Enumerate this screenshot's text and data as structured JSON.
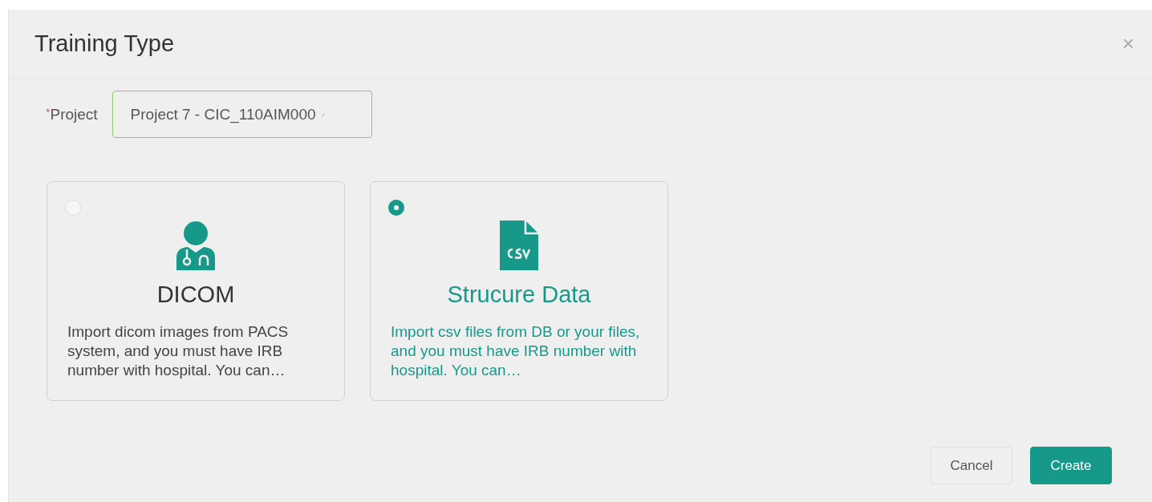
{
  "dialog": {
    "title": "Training Type",
    "close": "×"
  },
  "project_field": {
    "label": "Project",
    "required_mark": "*",
    "value": "Project 7 - CIC_110AIM000"
  },
  "options": [
    {
      "kind": "doctor",
      "title": "DICOM",
      "description": "Import dicom images from PACS system, and you must have IRB number with hospital. You can…",
      "selected": false
    },
    {
      "kind": "csv",
      "title": "Strucure Data",
      "description": "Import csv files from DB or your files, and you must have IRB number with hospital. You can…",
      "selected": true
    }
  ],
  "buttons": [
    {
      "kind": "secondary",
      "label": "Cancel"
    },
    {
      "kind": "primary",
      "label": "Create"
    }
  ]
}
